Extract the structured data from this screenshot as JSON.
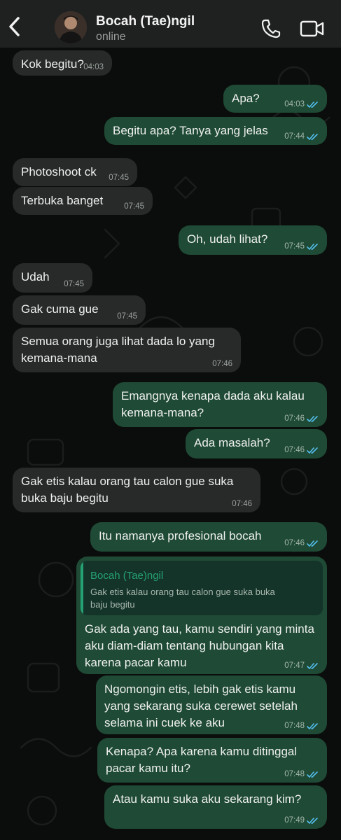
{
  "header": {
    "contact_name": "Bocah (Tae)ngil",
    "status": "online",
    "icons": [
      "back-chevron-icon",
      "avatar",
      "phone-icon",
      "video-camera-icon"
    ]
  },
  "colors": {
    "background": "#0b0d0c",
    "header": "#1f2120",
    "incoming_bubble": "#272a28",
    "outgoing_bubble": "#1f4a35",
    "read_ticks": "#53bdeb",
    "quote_accent": "#25a173"
  },
  "messages": [
    {
      "dir": "in",
      "text": "Kok begitu?",
      "time": "04:03"
    },
    {
      "dir": "out",
      "text": "Apa?",
      "time": "04:03",
      "status": "read"
    },
    {
      "dir": "out",
      "text": "Begitu apa? Tanya yang jelas",
      "time": "07:44",
      "status": "read"
    },
    {
      "dir": "in",
      "text": "Photoshoot ck",
      "time": "07:45"
    },
    {
      "dir": "in",
      "text": "Terbuka banget",
      "time": "07:45"
    },
    {
      "dir": "out",
      "text": "Oh, udah lihat?",
      "time": "07:45",
      "status": "read"
    },
    {
      "dir": "in",
      "text": "Udah",
      "time": "07:45"
    },
    {
      "dir": "in",
      "text": "Gak cuma gue",
      "time": "07:45"
    },
    {
      "dir": "in",
      "text": "Semua orang juga lihat dada lo yang kemana-mana",
      "time": "07:46"
    },
    {
      "dir": "out",
      "text": "Emangnya kenapa dada aku kalau kemana-mana?",
      "time": "07:46",
      "status": "read"
    },
    {
      "dir": "out",
      "text": "Ada masalah?",
      "time": "07:46",
      "status": "read"
    },
    {
      "dir": "in",
      "text": "Gak etis kalau orang tau calon gue suka buka baju begitu",
      "time": "07:46"
    },
    {
      "dir": "out",
      "text": "Itu namanya profesional bocah",
      "time": "07:46",
      "status": "read"
    },
    {
      "dir": "out",
      "text": "Gak ada yang tau, kamu sendiri yang minta aku diam-diam tentang hubungan kita karena pacar kamu",
      "time": "07:47",
      "status": "read",
      "reply_to": {
        "name": "Bocah (Tae)ngil",
        "text": "Gak etis kalau orang tau calon gue suka buka baju begitu"
      }
    },
    {
      "dir": "out",
      "text": "Ngomongin etis, lebih gak etis kamu yang sekarang suka cerewet setelah selama ini cuek ke aku",
      "time": "07:48",
      "status": "read"
    },
    {
      "dir": "out",
      "text": "Kenapa? Apa karena kamu ditinggal pacar kamu itu?",
      "time": "07:48",
      "status": "read"
    },
    {
      "dir": "out",
      "text": "Atau kamu suka aku sekarang kim?",
      "time": "07:49",
      "status": "read"
    }
  ]
}
